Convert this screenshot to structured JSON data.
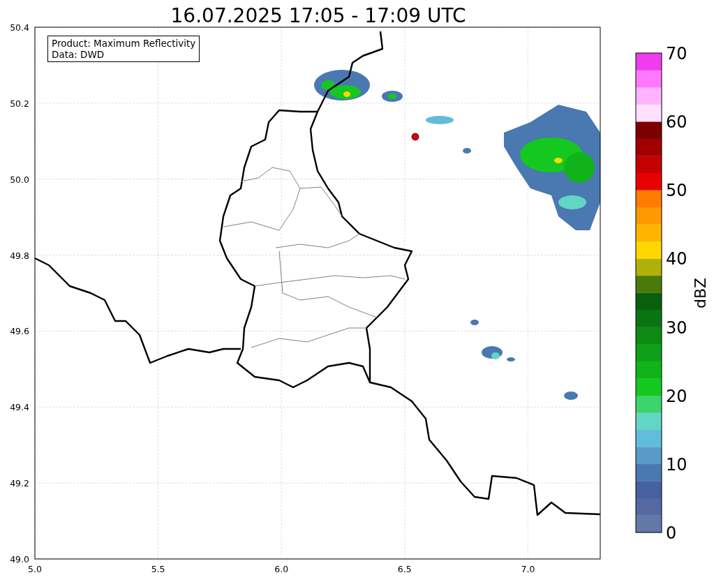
{
  "title": "16.07.2025 17:05 - 17:09 UTC",
  "legend": {
    "lines": [
      "Product: Maximum Reflectivity",
      "Data: DWD"
    ]
  },
  "x_axis": {
    "ticks": [
      "5.0",
      "5.5",
      "6.0",
      "6.5",
      "7.0"
    ]
  },
  "y_axis": {
    "ticks": [
      "50.4",
      "50.2",
      "50.0",
      "49.8",
      "49.6",
      "49.4",
      "49.2",
      "49.0"
    ]
  },
  "colorbar": {
    "label": "dBZ",
    "ticks": [
      "70",
      "60",
      "50",
      "40",
      "30",
      "20",
      "10",
      "0"
    ],
    "bands": [
      {
        "color": "#6478a8"
      },
      {
        "color": "#5568a0"
      },
      {
        "color": "#4660a0"
      },
      {
        "color": "#4a78b0"
      },
      {
        "color": "#5a9ac8"
      },
      {
        "color": "#62bcdc"
      },
      {
        "color": "#62d6c4"
      },
      {
        "color": "#3cd46c"
      },
      {
        "color": "#14c820"
      },
      {
        "color": "#10b41a"
      },
      {
        "color": "#0ea018"
      },
      {
        "color": "#0c8a14"
      },
      {
        "color": "#0a7412"
      },
      {
        "color": "#08600e"
      },
      {
        "color": "#4a7a0a"
      },
      {
        "color": "#b0b00a"
      },
      {
        "color": "#ffd800"
      },
      {
        "color": "#ffb400"
      },
      {
        "color": "#ff9800"
      },
      {
        "color": "#ff7c00"
      },
      {
        "color": "#e80000"
      },
      {
        "color": "#c40000"
      },
      {
        "color": "#a00000"
      },
      {
        "color": "#7c0000"
      },
      {
        "color": "#ffe0ff"
      },
      {
        "color": "#ffb4ff"
      },
      {
        "color": "#ff78ff"
      },
      {
        "color": "#ee3cee"
      }
    ]
  }
}
